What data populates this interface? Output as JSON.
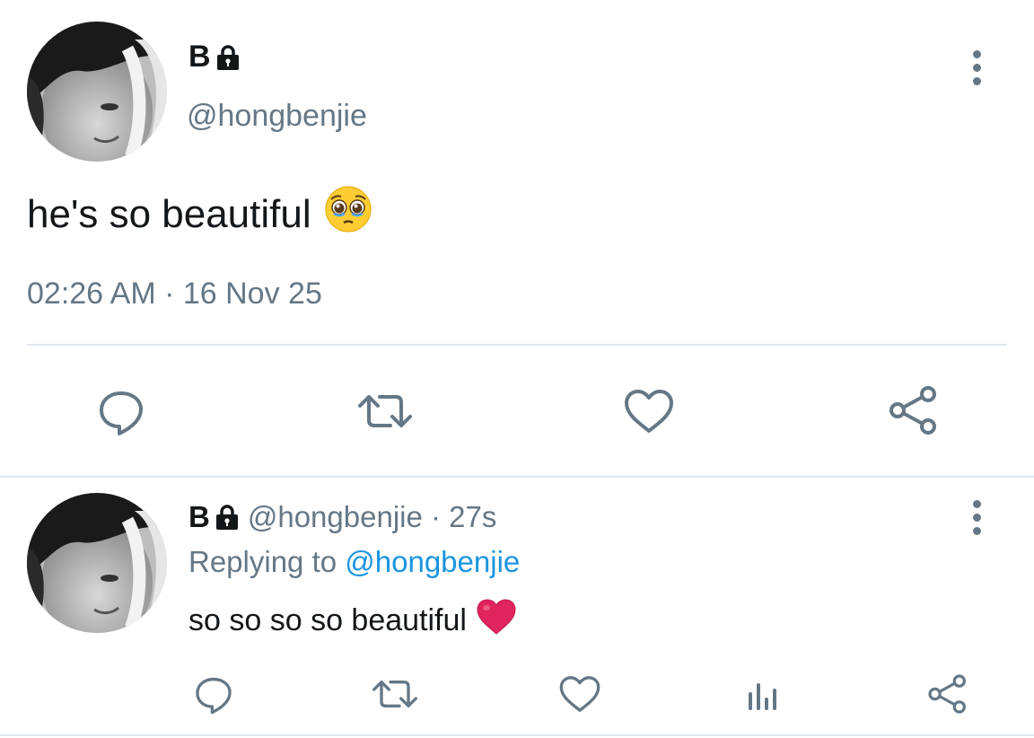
{
  "main_tweet": {
    "display_name": "B",
    "handle": "@hongbenjie",
    "text": "he's so beautiful",
    "emoji": "pleading-face",
    "timestamp": "02:26 AM · 16 Nov 25",
    "actions": [
      "reply-icon",
      "retweet-icon",
      "like-icon",
      "share-icon"
    ]
  },
  "reply_tweet": {
    "display_name": "B",
    "handle_time": "@hongbenjie · 27s",
    "replying_prefix": "Replying to ",
    "replying_to": "@hongbenjie",
    "text": "so so so so beautiful",
    "emoji": "red-heart",
    "actions": [
      "reply-icon",
      "retweet-icon",
      "like-icon",
      "analytics-icon",
      "share-icon"
    ]
  },
  "colors": {
    "text": "#14171a",
    "secondary": "#657786",
    "link": "#1b95e0",
    "divider": "#e1e8ed",
    "heart": "#e0245e"
  }
}
